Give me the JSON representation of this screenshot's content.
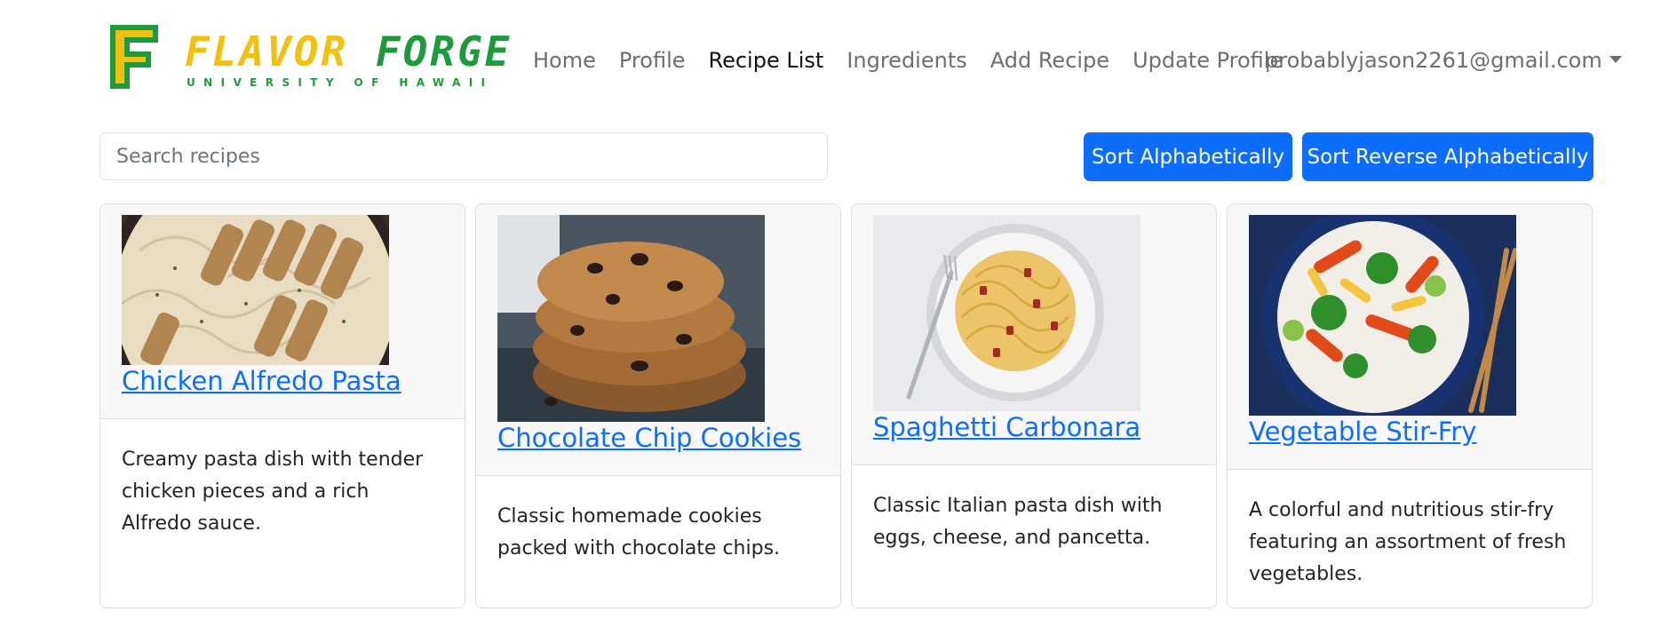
{
  "brand": {
    "name_part1": "FLAVOR",
    "name_part2": "FORGE",
    "subtitle": "UNIVERSITY OF HAWAII",
    "colors": {
      "gold": "#f2c00f",
      "green": "#1d9b3c"
    }
  },
  "nav": {
    "links": [
      "Home",
      "Profile",
      "Recipe List",
      "Ingredients",
      "Add Recipe",
      "Update Profile"
    ],
    "active": "Recipe List",
    "user_email": "probablyjason2261@gmail.com"
  },
  "search": {
    "placeholder": "Search recipes",
    "value": ""
  },
  "buttons": {
    "sort_alpha": "Sort Alphabetically",
    "sort_reverse": "Sort Reverse Alphabetically"
  },
  "recipes": [
    {
      "title": "Chicken Alfredo Pasta",
      "description": "Creamy pasta dish with tender chicken pieces and a rich Alfredo sauce.",
      "image": "chicken-alfredo-photo"
    },
    {
      "title": "Chocolate Chip Cookies",
      "description": "Classic homemade cookies packed with chocolate chips.",
      "image": "chocolate-chip-cookies-photo"
    },
    {
      "title": "Spaghetti Carbonara",
      "description": "Classic Italian pasta dish with eggs, cheese, and pancetta.",
      "image": "spaghetti-carbonara-photo"
    },
    {
      "title": "Vegetable Stir-Fry",
      "description": "A colorful and nutritious stir-fry featuring an assortment of fresh vegetables.",
      "image": "vegetable-stir-fry-photo"
    }
  ],
  "colors": {
    "primary": "#0d6efd",
    "card_header": "#f7f7f7",
    "border": "#dcdfe3"
  }
}
